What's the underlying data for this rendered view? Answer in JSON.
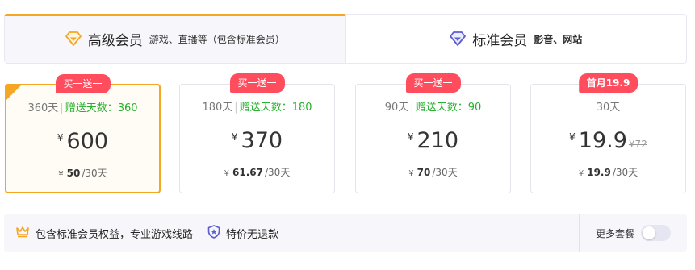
{
  "tabs": [
    {
      "title": "高级会员",
      "subtitle": "游戏、直播等（包含标准会员）",
      "icon": "diamond-gold-icon",
      "active": true
    },
    {
      "title": "标准会员",
      "subtitle": "影音、网站",
      "icon": "diamond-purple-icon",
      "active": false
    }
  ],
  "plans": [
    {
      "badge": "买一送一",
      "days": "360天",
      "gift": "赠送天数：360",
      "currency": "¥",
      "price": "600",
      "original": "",
      "unit_currency": "¥",
      "unit_price": "50",
      "unit_period": "/30天",
      "selected": true
    },
    {
      "badge": "买一送一",
      "days": "180天",
      "gift": "赠送天数：180",
      "currency": "¥",
      "price": "370",
      "original": "",
      "unit_currency": "¥",
      "unit_price": "61.67",
      "unit_period": "/30天",
      "selected": false
    },
    {
      "badge": "买一送一",
      "days": "90天",
      "gift": "赠送天数：90",
      "currency": "¥",
      "price": "210",
      "original": "",
      "unit_currency": "¥",
      "unit_price": "70",
      "unit_period": "/30天",
      "selected": false
    },
    {
      "badge": "首月19.9",
      "days": "30天",
      "gift": "",
      "currency": "¥",
      "price": "19.9",
      "original": "¥72",
      "unit_currency": "¥",
      "unit_price": "19.9",
      "unit_period": "/30天",
      "selected": false
    }
  ],
  "footer": {
    "benefit1": "包含标准会员权益，专业游戏线路",
    "benefit2": "特价无退款",
    "more_label": "更多套餐",
    "more_toggle_on": false
  },
  "colors": {
    "accent": "#f5a623",
    "badge": "#ff4d5e",
    "gift": "#27b02e",
    "purple": "#5b5bd6"
  }
}
